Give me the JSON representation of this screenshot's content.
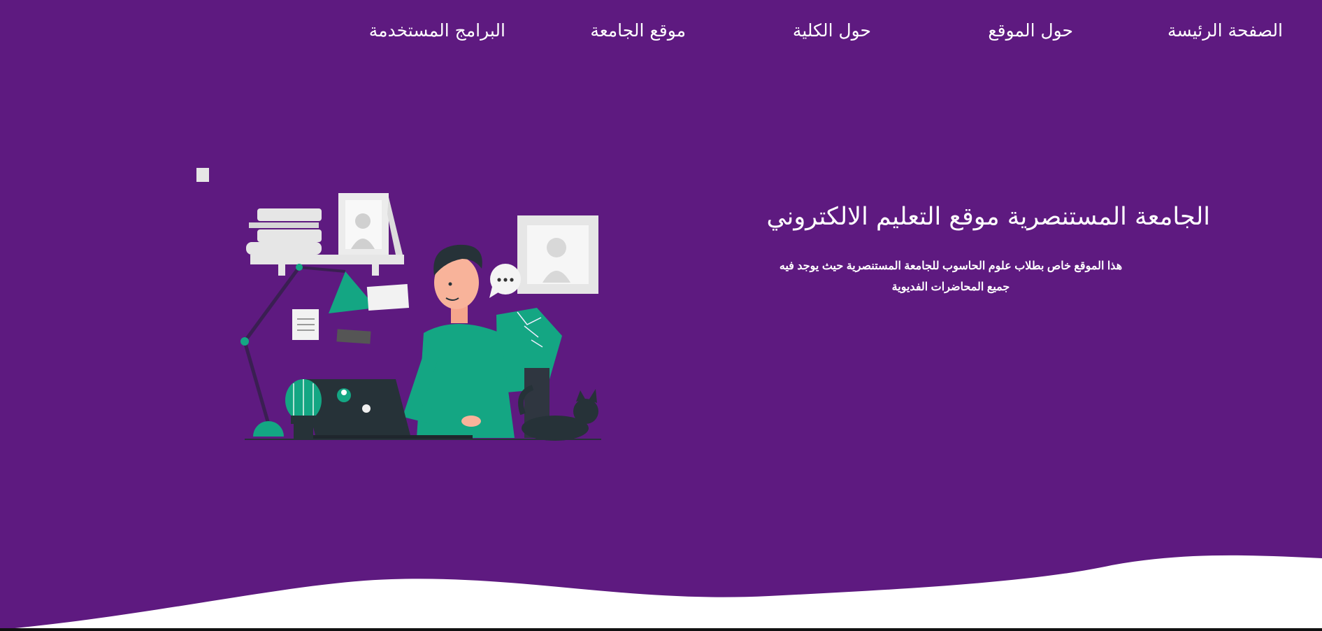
{
  "nav": {
    "items": [
      {
        "id": "home",
        "label": "الصفحة الرئيسة"
      },
      {
        "id": "about",
        "label": "حول الموقع"
      },
      {
        "id": "college",
        "label": "حول الكلية"
      },
      {
        "id": "university",
        "label": "موقع الجامعة"
      },
      {
        "id": "programs",
        "label": "البرامج المستخدمة"
      }
    ]
  },
  "hero": {
    "title": "الجامعة المستنصرية موقع التعليم الالكتروني",
    "description": "هذا الموقع خاص بطلاب علوم الحاسوب للجامعة المستنصرية حيث يوجد فيه جميع المحاضرات الفديوية"
  },
  "colors": {
    "background": "#5e1a80",
    "accent": "#14a683",
    "wave": "#ffffff"
  },
  "illustration": {
    "icons": [
      "person-at-laptop",
      "lamp-icon",
      "cactus-icon",
      "cat-icon",
      "picture-frame-icon",
      "speech-bubble-icon",
      "books-icon"
    ]
  }
}
